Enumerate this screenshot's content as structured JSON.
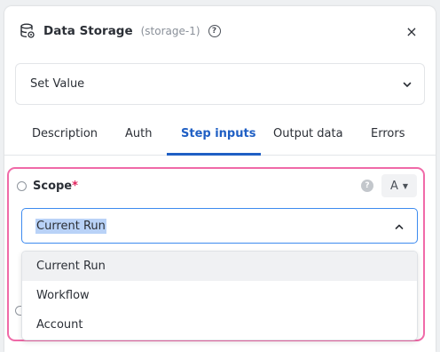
{
  "header": {
    "title": "Data Storage",
    "subtitle": "(storage-1)",
    "help_glyph": "?",
    "close_glyph": "×"
  },
  "action": {
    "selected": "Set Value"
  },
  "tabs": [
    {
      "label": "Description",
      "active": false
    },
    {
      "label": "Auth",
      "active": false
    },
    {
      "label": "Step inputs",
      "active": true
    },
    {
      "label": "Output data",
      "active": false
    },
    {
      "label": "Errors",
      "active": false
    }
  ],
  "scope": {
    "label": "Scope",
    "required_mark": "*",
    "help_glyph": "?",
    "type_toggle": "A",
    "selected": "Current Run",
    "options": [
      "Current Run",
      "Workflow",
      "Account"
    ]
  },
  "colors": {
    "accent": "#1f5fc4",
    "focus_border": "#3d8bef",
    "highlight_border": "#f06aa8",
    "required": "#e0245e"
  }
}
